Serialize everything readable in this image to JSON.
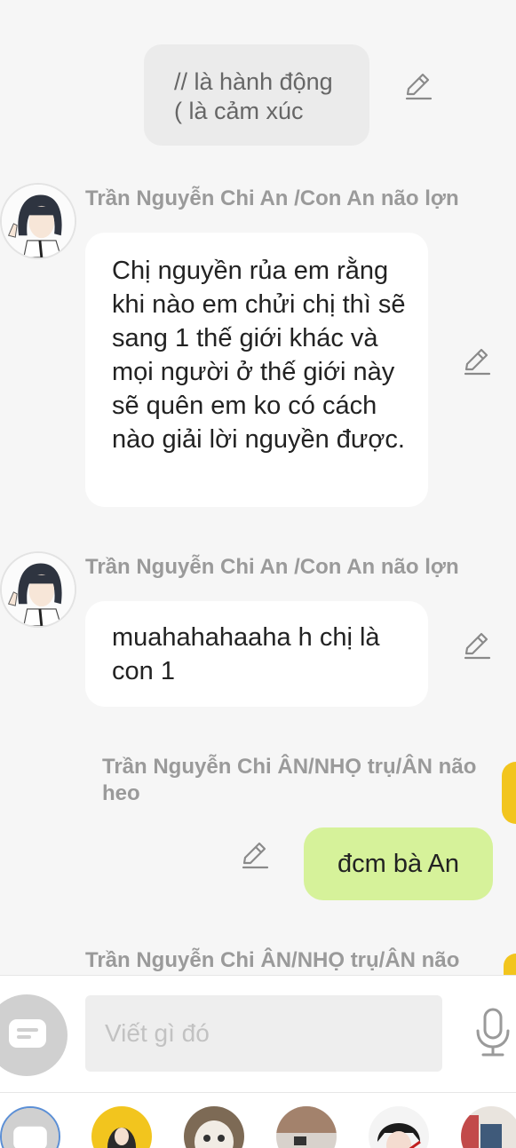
{
  "system_note": {
    "text": "// là hành động\n( là cảm xúc"
  },
  "messages": [
    {
      "sender": "Trần Nguyễn Chi An /Con An não lợn",
      "text": "Chị nguyền rủa em rằng khi nào em chửi chị thì sẽ sang 1 thế giới khác và mọi người ở thế giới này sẽ quên em ko có cách nào giải lời nguyền được."
    },
    {
      "sender": "Trần Nguyễn Chi An /Con An não lợn",
      "text": "muahahahaaha h chị là con 1"
    },
    {
      "sender": "Trần Nguyễn Chi ÂN/NHỌ trụ/ÂN não heo",
      "text": "đcm bà An"
    },
    {
      "sender": "Trần Nguyễn Chi ÂN/NHỌ trụ/ÂN não"
    }
  ],
  "composer": {
    "placeholder": "Viết gì đó"
  },
  "icons": {
    "edit": "pencil-icon",
    "mic": "microphone-icon",
    "chat": "chat-bubble-icon"
  },
  "colors": {
    "own_bubble": "#d6f29a",
    "other_bubble": "#ffffff",
    "system_bubble": "#ebebeb",
    "sender_name": "#9a9a9a",
    "accent_yellow": "#f2c51e"
  }
}
